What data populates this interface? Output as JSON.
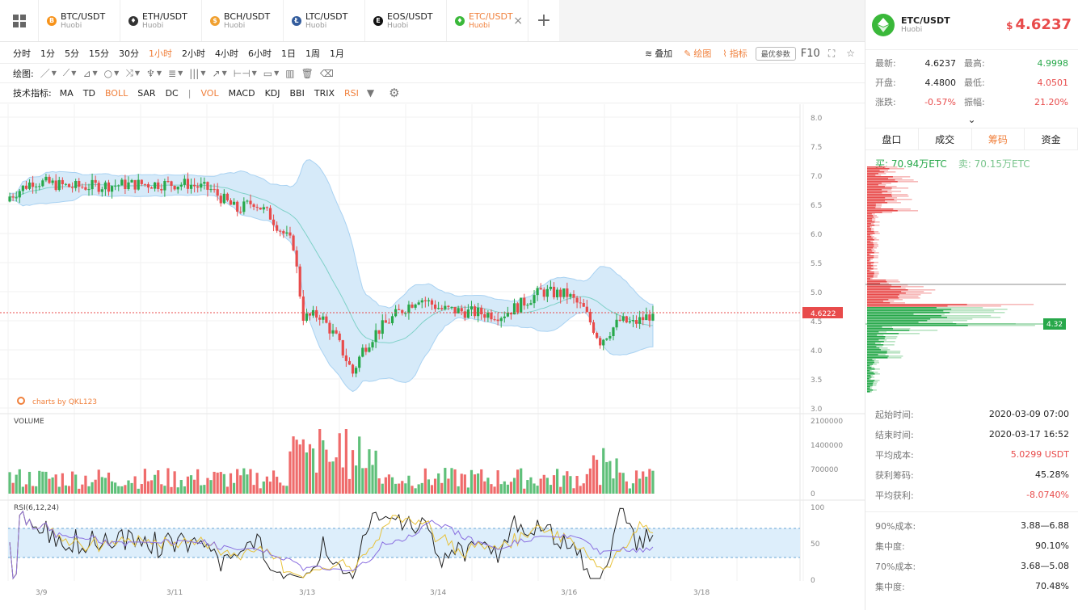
{
  "tabs": [
    {
      "name": "BTC/USDT",
      "sub": "Huobi",
      "icon": "bitcoin-icon",
      "color": "#f7931a",
      "glyph": "B"
    },
    {
      "name": "ETH/USDT",
      "sub": "Huobi",
      "icon": "ethereum-icon",
      "color": "#333333",
      "glyph": "♦"
    },
    {
      "name": "BCH/USDT",
      "sub": "Huobi",
      "icon": "bitcoin-cash-icon",
      "color": "#f0a030",
      "glyph": "$"
    },
    {
      "name": "LTC/USDT",
      "sub": "Huobi",
      "icon": "litecoin-icon",
      "color": "#345d9d",
      "glyph": "Ł"
    },
    {
      "name": "EOS/USDT",
      "sub": "Huobi",
      "icon": "eos-icon",
      "color": "#111111",
      "glyph": "E"
    },
    {
      "name": "ETC/USDT",
      "sub": "Huobi",
      "icon": "etc-icon",
      "color": "#3ab83a",
      "glyph": "♦",
      "active": true
    }
  ],
  "timeframes": [
    "分时",
    "1分",
    "5分",
    "15分",
    "30分",
    "1小时",
    "2小时",
    "4小时",
    "6小时",
    "1日",
    "1周",
    "1月"
  ],
  "active_timeframe": "1小时",
  "top_right": {
    "overlay": "叠加",
    "draw": "绘图",
    "indicator": "指标",
    "best_params": "最优参数",
    "f10": "F10"
  },
  "draw_label": "绘图:",
  "indicator_label": "技术指标:",
  "indicators": [
    "MA",
    "TD",
    "BOLL",
    "SAR",
    "DC",
    "|",
    "VOL",
    "MACD",
    "KDJ",
    "BBI",
    "TRIX",
    "RSI"
  ],
  "active_indicators": [
    "BOLL",
    "VOL",
    "RSI"
  ],
  "chart": {
    "price_ticks": [
      "8.0",
      "7.5",
      "7.0",
      "6.5",
      "6.0",
      "5.5",
      "5.0",
      "4.5",
      "4.0",
      "3.5",
      "3.0"
    ],
    "current_price_tag": "4.6222",
    "watermark": "charts by QKL123",
    "volume_label": "VOLUME",
    "volume_ticks": [
      "2100000",
      "1400000",
      "700000",
      "0"
    ],
    "rsi_label": "RSI(6,12,24)",
    "rsi_ticks": [
      "100",
      "50",
      "0"
    ],
    "date_ticks": [
      "3/9",
      "3/11",
      "3/13",
      "3/14",
      "3/16",
      "3/18"
    ],
    "colors": {
      "up": "#27a84a",
      "down": "#e84b4b",
      "band": "#d6eaf9",
      "mid": "#7fd1c8"
    }
  },
  "sidebar": {
    "pair": "ETC/USDT",
    "exchange": "Huobi",
    "price_symbol": "$",
    "price": "4.6237",
    "stats": [
      {
        "k": "最新:",
        "v": "4.6237",
        "k2": "最高:",
        "v2": "4.9998",
        "c2": "grn"
      },
      {
        "k": "开盘:",
        "v": "4.4800",
        "k2": "最低:",
        "v2": "4.0501",
        "c2": "red"
      },
      {
        "k": "涨跌:",
        "v": "-0.57%",
        "k2": "振幅:",
        "v2": "21.20%",
        "c1": "red",
        "c2": "red"
      }
    ],
    "tabs": [
      "盘口",
      "成交",
      "筹码",
      "资金"
    ],
    "active_tab": "筹码",
    "buy": "买: 70.94万ETC",
    "sell": "卖: 70.15万ETC",
    "depth_price": "4.32",
    "summary1": [
      {
        "k": "起始时间:",
        "v": "2020-03-09 07:00"
      },
      {
        "k": "结束时间:",
        "v": "2020-03-17 16:52"
      },
      {
        "k": "平均成本:",
        "v": "5.0299 USDT",
        "c": "red"
      },
      {
        "k": "获利筹码:",
        "v": "45.28%"
      },
      {
        "k": "平均获利:",
        "v": "-8.0740%",
        "c": "red"
      }
    ],
    "summary2": [
      {
        "k": "90%成本:",
        "v": "3.88—6.88"
      },
      {
        "k": "集中度:",
        "v": "90.10%"
      },
      {
        "k": "70%成本:",
        "v": "3.68—5.08"
      },
      {
        "k": "集中度:",
        "v": "70.48%"
      }
    ]
  }
}
